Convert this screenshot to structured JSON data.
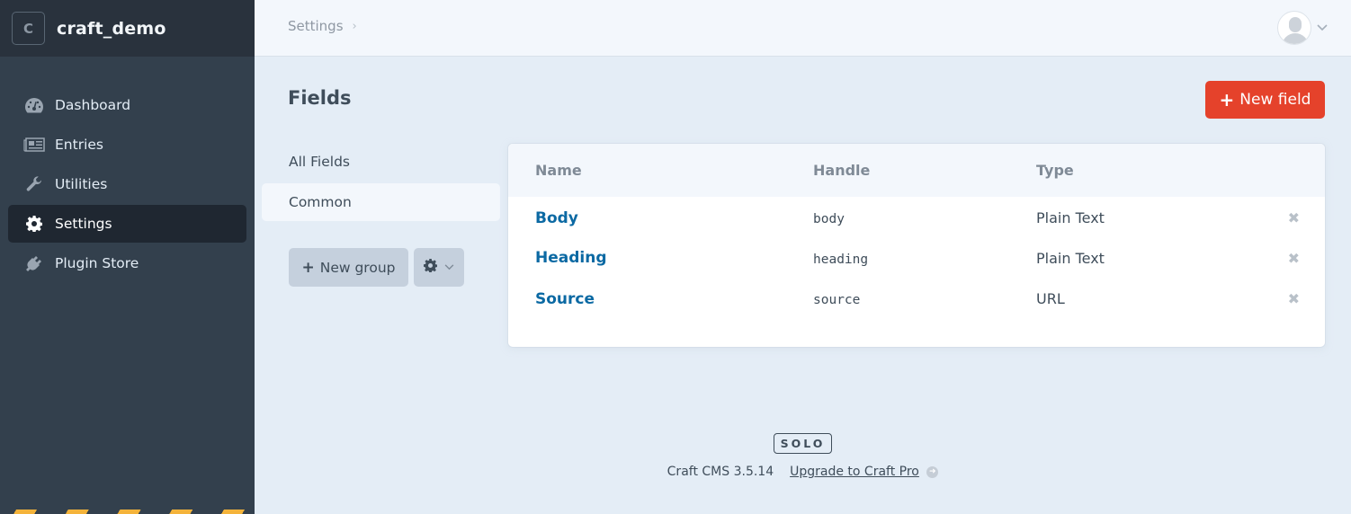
{
  "site": {
    "logo_letter": "C",
    "name": "craft_demo"
  },
  "nav": {
    "items": [
      {
        "label": "Dashboard",
        "icon": "dashboard-icon",
        "active": false
      },
      {
        "label": "Entries",
        "icon": "newspaper-icon",
        "active": false
      },
      {
        "label": "Utilities",
        "icon": "wrench-icon",
        "active": false
      },
      {
        "label": "Settings",
        "icon": "gear-icon",
        "active": true
      },
      {
        "label": "Plugin Store",
        "icon": "plug-icon",
        "active": false
      }
    ]
  },
  "header": {
    "breadcrumb": [
      {
        "label": "Settings"
      }
    ],
    "breadcrumb_separator": "›",
    "account_chevron": "⌄"
  },
  "page": {
    "title": "Fields",
    "new_field_label": "New field",
    "plus_glyph": "+"
  },
  "groups": {
    "items": [
      {
        "label": "All Fields",
        "active": false
      },
      {
        "label": "Common",
        "active": true
      }
    ],
    "new_group_label": "New group",
    "settings_chevron": "⌄"
  },
  "table": {
    "columns": [
      "Name",
      "Handle",
      "Type"
    ],
    "rows": [
      {
        "name": "Body",
        "handle": "body",
        "type": "Plain Text"
      },
      {
        "name": "Heading",
        "handle": "heading",
        "type": "Plain Text"
      },
      {
        "name": "Source",
        "handle": "source",
        "type": "URL"
      }
    ],
    "delete_glyph": "✖"
  },
  "footer": {
    "edition": "SOLO",
    "version": "Craft CMS 3.5.14",
    "upgrade_label": "Upgrade to Craft Pro",
    "arrow_glyph": "➜"
  },
  "colors": {
    "accent_red": "#e5422b",
    "link_blue": "#0b69a3",
    "sidebar_bg": "#33404d",
    "sidebar_header_bg": "#29323d",
    "stripe_yellow": "#f4b33a"
  }
}
